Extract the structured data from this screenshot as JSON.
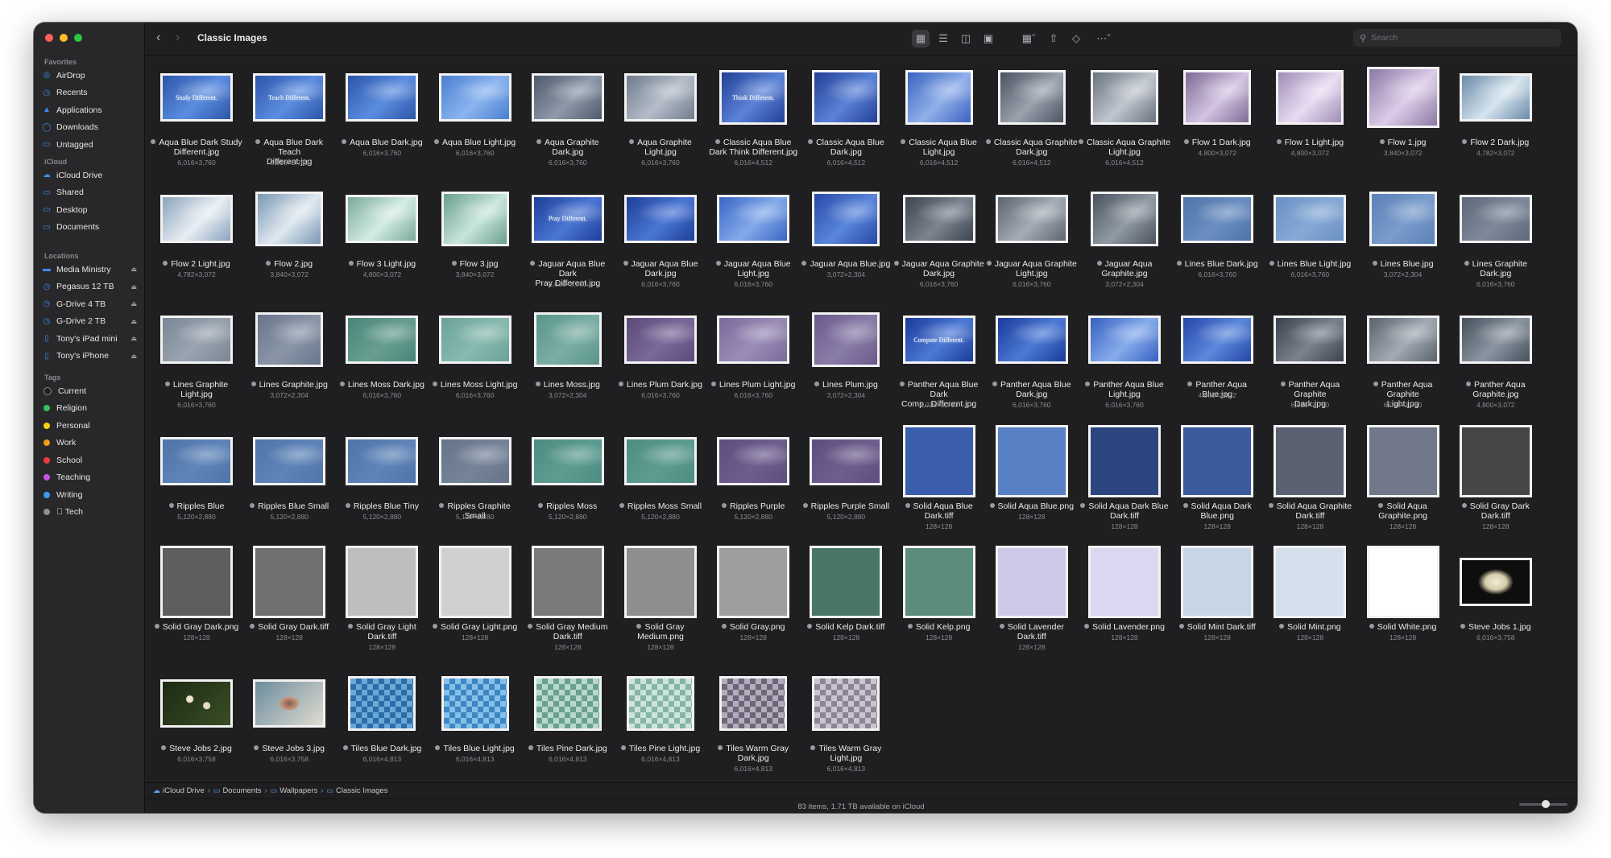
{
  "window": {
    "title": "Classic Images"
  },
  "sidebar": {
    "favorites_label": "Favorites",
    "favorites": [
      {
        "label": "AirDrop",
        "icon": "airdrop-icon"
      },
      {
        "label": "Recents",
        "icon": "clock-icon"
      },
      {
        "label": "Applications",
        "icon": "applications-icon"
      },
      {
        "label": "Downloads",
        "icon": "download-icon"
      },
      {
        "label": "Untagged",
        "icon": "folder-icon"
      }
    ],
    "icloud_label": "iCloud",
    "icloud": [
      {
        "label": "iCloud Drive",
        "icon": "cloud-icon"
      },
      {
        "label": "Shared",
        "icon": "shared-folder-icon"
      },
      {
        "label": "Desktop",
        "icon": "desktop-icon"
      },
      {
        "label": "Documents",
        "icon": "document-icon"
      }
    ],
    "locations_label": "Locations",
    "locations": [
      {
        "label": "Media Ministry",
        "icon": "drive-icon"
      },
      {
        "label": "Pegasus 12 TB",
        "icon": "clock-drive-icon"
      },
      {
        "label": "G-Drive 4 TB",
        "icon": "clock-drive-icon"
      },
      {
        "label": "G-Drive 2 TB",
        "icon": "clock-drive-icon"
      },
      {
        "label": "Tony's iPad mini",
        "icon": "ipad-icon"
      },
      {
        "label": "Tony's iPhone",
        "icon": "iphone-icon"
      }
    ],
    "tags_label": "Tags",
    "tags": [
      {
        "label": "Current",
        "color": "#1f1f21"
      },
      {
        "label": "Religion",
        "color": "#32c15a"
      },
      {
        "label": "Personal",
        "color": "#f5d10d"
      },
      {
        "label": "Work",
        "color": "#f09b12"
      },
      {
        "label": "School",
        "color": "#ee3b3b"
      },
      {
        "label": "Teaching",
        "color": "#c555e0"
      },
      {
        "label": "Writing",
        "color": "#3b9af5"
      },
      {
        "label": "Tech",
        "color": "#8e8e93",
        "prefix": " "
      }
    ]
  },
  "toolbar": {
    "back_icon": "chevron-left-icon",
    "forward_icon": "chevron-right-icon",
    "search_placeholder": "Search"
  },
  "files": [
    {
      "n1": "Aqua Blue Dark Study",
      "n2": "Different.jpg",
      "d": "6,016×3,760",
      "c": [
        "#2c55a8",
        "#5b8de0"
      ],
      "t": "Study Different.",
      "s": "w"
    },
    {
      "n1": "Aqua Blue Dark Teach",
      "n2": "Different.jpg",
      "d": "6,016×3,760",
      "c": [
        "#2c55a8",
        "#5b8de0"
      ],
      "t": "Teach Different.",
      "s": "w"
    },
    {
      "n1": "Aqua Blue Dark.jpg",
      "n2": "",
      "d": "6,016×3,760",
      "c": [
        "#2c55a8",
        "#5b8de0"
      ],
      "s": "w"
    },
    {
      "n1": "Aqua Blue Light.jpg",
      "n2": "",
      "d": "6,016×3,760",
      "c": [
        "#4a7fd0",
        "#8ab4f0"
      ],
      "s": "w"
    },
    {
      "n1": "Aqua Graphite",
      "n2": "Dark.jpg",
      "d": "6,016×3,760",
      "c": [
        "#4e5a6a",
        "#8e9aaa"
      ],
      "s": "w"
    },
    {
      "n1": "Aqua Graphite",
      "n2": "Light.jpg",
      "d": "6,016×3,760",
      "c": [
        "#707c8c",
        "#b4bcc8"
      ],
      "s": "w"
    },
    {
      "n1": "Classic Aqua Blue",
      "n2": "Dark Think Different.jpg",
      "d": "6,016×4,512",
      "c": [
        "#223f94",
        "#5a82d8"
      ],
      "t": "Think Different.",
      "s": "t"
    },
    {
      "n1": "Classic Aqua Blue",
      "n2": "Dark.jpg",
      "d": "6,016×4,512",
      "c": [
        "#223f94",
        "#5a82d8"
      ],
      "s": "t"
    },
    {
      "n1": "Classic Aqua Blue",
      "n2": "Light.jpg",
      "d": "6,016×4,512",
      "c": [
        "#3a62c0",
        "#90b0ea"
      ],
      "s": "t"
    },
    {
      "n1": "Classic Aqua Graphite",
      "n2": "Dark.jpg",
      "d": "6,016×4,512",
      "c": [
        "#4a5260",
        "#9aa2ae"
      ],
      "s": "t"
    },
    {
      "n1": "Classic Aqua Graphite",
      "n2": "Light.jpg",
      "d": "6,016×4,512",
      "c": [
        "#6a7280",
        "#c0c6ce"
      ],
      "s": "t"
    },
    {
      "n1": "Flow 1 Dark.jpg",
      "n2": "",
      "d": "4,800×3,072",
      "c": [
        "#7e6a94",
        "#d4c4e2"
      ],
      "s": "t"
    },
    {
      "n1": "Flow 1 Light.jpg",
      "n2": "",
      "d": "4,800×3,072",
      "c": [
        "#a08cb6",
        "#e8dcf2"
      ],
      "s": "t"
    },
    {
      "n1": "Flow 1.jpg",
      "n2": "",
      "d": "3,840×3,072",
      "c": [
        "#8c78a4",
        "#dccce8"
      ],
      "s": "tl"
    },
    {
      "n1": "Flow 2 Dark.jpg",
      "n2": "",
      "d": "4,782×3,072",
      "c": [
        "#6a8aa8",
        "#d6e4ee"
      ],
      "s": "w"
    },
    {
      "n1": "Flow 2 Light.jpg",
      "n2": "",
      "d": "4,782×3,072",
      "c": [
        "#8aa4bc",
        "#e8eef4"
      ],
      "s": "w"
    },
    {
      "n1": "Flow 2.jpg",
      "n2": "",
      "d": "3,840×3,072",
      "c": [
        "#7a98b4",
        "#dfe8f0"
      ],
      "s": "t"
    },
    {
      "n1": "Flow 3 Light.jpg",
      "n2": "",
      "d": "4,800×3,072",
      "c": [
        "#7aaa9a",
        "#d4ece2"
      ],
      "s": "w"
    },
    {
      "n1": "Flow 3.jpg",
      "n2": "",
      "d": "3,840×3,072",
      "c": [
        "#6a9e8e",
        "#c8e6da"
      ],
      "s": "t"
    },
    {
      "n1": "Jaguar Aqua Blue Dark",
      "n2": "Pray Different.jpg",
      "d": "6,016×3,760",
      "c": [
        "#1e3e98",
        "#4a76d4"
      ],
      "t": "Pray Different.",
      "s": "w"
    },
    {
      "n1": "Jaguar Aqua Blue",
      "n2": "Dark.jpg",
      "d": "6,016×3,760",
      "c": [
        "#1e3e98",
        "#4a76d4"
      ],
      "s": "w"
    },
    {
      "n1": "Jaguar Aqua Blue",
      "n2": "Light.jpg",
      "d": "6,016×3,760",
      "c": [
        "#3a66c4",
        "#84aaea"
      ],
      "s": "w"
    },
    {
      "n1": "Jaguar Aqua Blue.jpg",
      "n2": "",
      "d": "3,072×2,304",
      "c": [
        "#2648a8",
        "#5a86dc"
      ],
      "s": "t"
    },
    {
      "n1": "Jaguar Aqua Graphite",
      "n2": "Dark.jpg",
      "d": "6,016×3,760",
      "c": [
        "#3c4450",
        "#7c8490"
      ],
      "s": "w"
    },
    {
      "n1": "Jaguar Aqua Graphite",
      "n2": "Light.jpg",
      "d": "6,016×3,760",
      "c": [
        "#5c646e",
        "#a4acb6"
      ],
      "s": "w"
    },
    {
      "n1": "Jaguar Aqua",
      "n2": "Graphite.jpg",
      "d": "3,072×2,304",
      "c": [
        "#4a525e",
        "#909aa4"
      ],
      "s": "t"
    },
    {
      "n1": "Lines Blue Dark.jpg",
      "n2": "",
      "d": "6,016×3,760",
      "c": [
        "#4e74a8",
        "#6a8ec0"
      ],
      "s": "w"
    },
    {
      "n1": "Lines Blue Light.jpg",
      "n2": "",
      "d": "6,016×3,760",
      "c": [
        "#6a90c4",
        "#86aad6"
      ],
      "s": "w"
    },
    {
      "n1": "Lines Blue.jpg",
      "n2": "",
      "d": "3,072×2,304",
      "c": [
        "#5a80b6",
        "#7a9ccc"
      ],
      "s": "t"
    },
    {
      "n1": "Lines Graphite",
      "n2": "Dark.jpg",
      "d": "6,016×3,760",
      "c": [
        "#5c6878",
        "#7e8a9a"
      ],
      "s": "w"
    },
    {
      "n1": "Lines Graphite",
      "n2": "Light.jpg",
      "d": "6,016×3,760",
      "c": [
        "#7a8694",
        "#9aa4b0"
      ],
      "s": "w"
    },
    {
      "n1": "Lines Graphite.jpg",
      "n2": "",
      "d": "3,072×2,304",
      "c": [
        "#68748a",
        "#8a96a8"
      ],
      "s": "t"
    },
    {
      "n1": "Lines Moss Dark.jpg",
      "n2": "",
      "d": "6,016×3,760",
      "c": [
        "#4a8478",
        "#689e92"
      ],
      "s": "w"
    },
    {
      "n1": "Lines Moss Light.jpg",
      "n2": "",
      "d": "6,016×3,760",
      "c": [
        "#6aa298",
        "#88bab0"
      ],
      "s": "w"
    },
    {
      "n1": "Lines Moss.jpg",
      "n2": "",
      "d": "3,072×2,304",
      "c": [
        "#5a958a",
        "#7aaea4"
      ],
      "s": "t"
    },
    {
      "n1": "Lines Plum Dark.jpg",
      "n2": "",
      "d": "6,016×3,760",
      "c": [
        "#5c4a7c",
        "#7a6898"
      ],
      "s": "w"
    },
    {
      "n1": "Lines Plum Light.jpg",
      "n2": "",
      "d": "6,016×3,760",
      "c": [
        "#7a6a9c",
        "#9a8cb6"
      ],
      "s": "w"
    },
    {
      "n1": "Lines Plum.jpg",
      "n2": "",
      "d": "3,072×2,304",
      "c": [
        "#6a5a8c",
        "#8a7ca8"
      ],
      "s": "t"
    },
    {
      "n1": "Panther Aqua Blue",
      "n2": "Dark Comp...Different.jpg",
      "d": "6,016×3,760",
      "c": [
        "#1a3a98",
        "#4c7ad6"
      ],
      "t": "Compute Different.",
      "s": "w"
    },
    {
      "n1": "Panther Aqua Blue",
      "n2": "Dark.jpg",
      "d": "6,016×3,760",
      "c": [
        "#1a3a98",
        "#4c7ad6"
      ],
      "s": "w"
    },
    {
      "n1": "Panther Aqua Blue",
      "n2": "Light.jpg",
      "d": "6,016×3,760",
      "c": [
        "#3660c0",
        "#86acec"
      ],
      "s": "w"
    },
    {
      "n1": "Panther Aqua Blue.jpg",
      "n2": "",
      "d": "4,800×3,072",
      "c": [
        "#2446a8",
        "#5c88dc"
      ],
      "s": "w"
    },
    {
      "n1": "Panther Aqua Graphite",
      "n2": "Dark.jpg",
      "d": "6,016×3,760",
      "c": [
        "#3a424e",
        "#7a828e"
      ],
      "s": "w"
    },
    {
      "n1": "Panther Aqua Graphite",
      "n2": "Light.jpg",
      "d": "6,016×3,760",
      "c": [
        "#5a626c",
        "#a2aab4"
      ],
      "s": "w"
    },
    {
      "n1": "Panther Aqua",
      "n2": "Graphite.jpg",
      "d": "4,800×3,072",
      "c": [
        "#46505c",
        "#8c96a2"
      ],
      "s": "w"
    },
    {
      "n1": "Ripples Blue",
      "n2": "",
      "d": "5,120×2,880",
      "c": [
        "#4e74a8",
        "#5e84b8"
      ],
      "s": "w"
    },
    {
      "n1": "Ripples Blue Small",
      "n2": "",
      "d": "5,120×2,880",
      "c": [
        "#4e74a8",
        "#5e84b8"
      ],
      "s": "w"
    },
    {
      "n1": "Ripples Blue Tiny",
      "n2": "",
      "d": "5,120×2,880",
      "c": [
        "#4e74a8",
        "#5e84b8"
      ],
      "s": "w"
    },
    {
      "n1": "Ripples Graphite Small",
      "n2": "",
      "d": "5,120×2,880",
      "c": [
        "#66748a",
        "#76849a"
      ],
      "s": "w"
    },
    {
      "n1": "Ripples Moss",
      "n2": "",
      "d": "5,120×2,880",
      "c": [
        "#4e8c82",
        "#5e9c92"
      ],
      "s": "w"
    },
    {
      "n1": "Ripples Moss Small",
      "n2": "",
      "d": "5,120×2,880",
      "c": [
        "#4e8c82",
        "#5e9c92"
      ],
      "s": "w"
    },
    {
      "n1": "Ripples Purple",
      "n2": "",
      "d": "5,120×2,880",
      "c": [
        "#5e4e7e",
        "#6e5e8e"
      ],
      "s": "w"
    },
    {
      "n1": "Ripples Purple Small",
      "n2": "",
      "d": "5,120×2,880",
      "c": [
        "#5e4e7e",
        "#6e5e8e"
      ],
      "s": "w"
    },
    {
      "n1": "Solid Aqua Blue",
      "n2": "Dark.tiff",
      "d": "128×128",
      "c": [
        "#3a5eac",
        "#3a5eac"
      ],
      "s": "sq"
    },
    {
      "n1": "Solid Aqua Blue.png",
      "n2": "",
      "d": "128×128",
      "c": [
        "#5880c4",
        "#5880c4"
      ],
      "s": "sq"
    },
    {
      "n1": "Solid Aqua Dark Blue",
      "n2": "Dark.tiff",
      "d": "128×128",
      "c": [
        "#2c4680",
        "#2c4680"
      ],
      "s": "sq"
    },
    {
      "n1": "Solid Aqua Dark",
      "n2": "Blue.png",
      "d": "128×128",
      "c": [
        "#3c5a9e",
        "#3c5a9e"
      ],
      "s": "sq"
    },
    {
      "n1": "Solid Aqua Graphite",
      "n2": "Dark.tiff",
      "d": "128×128",
      "c": [
        "#5a6272",
        "#5a6272"
      ],
      "s": "sq"
    },
    {
      "n1": "Solid Aqua",
      "n2": "Graphite.png",
      "d": "128×128",
      "c": [
        "#70788a",
        "#70788a"
      ],
      "s": "sq"
    },
    {
      "n1": "Solid Gray Dark",
      "n2": "Dark.tiff",
      "d": "128×128",
      "c": [
        "#464646",
        "#464646"
      ],
      "s": "sq"
    },
    {
      "n1": "Solid Gray Dark.png",
      "n2": "",
      "d": "128×128",
      "c": [
        "#5e5e5e",
        "#5e5e5e"
      ],
      "s": "sq"
    },
    {
      "n1": "Solid Gray Dark.tiff",
      "n2": "",
      "d": "128×128",
      "c": [
        "#707070",
        "#707070"
      ],
      "s": "sq"
    },
    {
      "n1": "Solid Gray Light",
      "n2": "Dark.tiff",
      "d": "128×128",
      "c": [
        "#bebebe",
        "#bebebe"
      ],
      "s": "sq"
    },
    {
      "n1": "Solid Gray Light.png",
      "n2": "",
      "d": "128×128",
      "c": [
        "#cfcfcf",
        "#cfcfcf"
      ],
      "s": "sq"
    },
    {
      "n1": "Solid Gray Medium",
      "n2": "Dark.tiff",
      "d": "128×128",
      "c": [
        "#7a7a7a",
        "#7a7a7a"
      ],
      "s": "sq"
    },
    {
      "n1": "Solid Gray",
      "n2": "Medium.png",
      "d": "128×128",
      "c": [
        "#8e8e8e",
        "#8e8e8e"
      ],
      "s": "sq"
    },
    {
      "n1": "Solid Gray.png",
      "n2": "",
      "d": "128×128",
      "c": [
        "#9e9e9e",
        "#9e9e9e"
      ],
      "s": "sq"
    },
    {
      "n1": "Solid Kelp Dark.tiff",
      "n2": "",
      "d": "128×128",
      "c": [
        "#4a7666",
        "#4a7666"
      ],
      "s": "sq"
    },
    {
      "n1": "Solid Kelp.png",
      "n2": "",
      "d": "128×128",
      "c": [
        "#5c8c7c",
        "#5c8c7c"
      ],
      "s": "sq"
    },
    {
      "n1": "Solid Lavender",
      "n2": "Dark.tiff",
      "d": "128×128",
      "c": [
        "#d0c8e8",
        "#d0c8e8"
      ],
      "s": "sq"
    },
    {
      "n1": "Solid Lavender.png",
      "n2": "",
      "d": "128×128",
      "c": [
        "#ddd6f0",
        "#ddd6f0"
      ],
      "s": "sq"
    },
    {
      "n1": "Solid Mint Dark.tiff",
      "n2": "",
      "d": "128×128",
      "c": [
        "#c6d6e6",
        "#c6d6e6"
      ],
      "s": "sq"
    },
    {
      "n1": "Solid Mint.png",
      "n2": "",
      "d": "128×128",
      "c": [
        "#d4e0ec",
        "#d4e0ec"
      ],
      "s": "sq"
    },
    {
      "n1": "Solid White.png",
      "n2": "",
      "d": "128×128",
      "c": [
        "#ffffff",
        "#ffffff"
      ],
      "s": "sq"
    },
    {
      "n1": "Steve Jobs 1.jpg",
      "n2": "",
      "d": "6,016×3,758",
      "c": [
        "#0e0e0c",
        "#1c1c18"
      ],
      "s": "w",
      "img": "flower"
    },
    {
      "n1": "Steve Jobs 2.jpg",
      "n2": "",
      "d": "6,016×3,758",
      "c": [
        "#1c2a14",
        "#3a4e26"
      ],
      "s": "w",
      "img": "leaves"
    },
    {
      "n1": "Steve Jobs 3.jpg",
      "n2": "",
      "d": "6,016×3,758",
      "c": [
        "#6c8c9e",
        "#e0dcd0"
      ],
      "s": "w",
      "img": "blossom"
    },
    {
      "n1": "Tiles Blue Dark.jpg",
      "n2": "",
      "d": "6,016×4,813",
      "c": [
        "#2a6ea8",
        "#6aa8d8"
      ],
      "s": "t",
      "img": "tiles"
    },
    {
      "n1": "Tiles Blue Light.jpg",
      "n2": "",
      "d": "6,016×4,813",
      "c": [
        "#3c86c4",
        "#86c0e8"
      ],
      "s": "t",
      "img": "tiles"
    },
    {
      "n1": "Tiles Pine Dark.jpg",
      "n2": "",
      "d": "6,016×4,813",
      "c": [
        "#6aa090",
        "#b8d8cc"
      ],
      "s": "t",
      "img": "tiles"
    },
    {
      "n1": "Tiles Pine Light.jpg",
      "n2": "",
      "d": "6,016×4,813",
      "c": [
        "#86b4a6",
        "#cce4da"
      ],
      "s": "t",
      "img": "tiles"
    },
    {
      "n1": "Tiles Warm Gray",
      "n2": "Dark.jpg",
      "d": "6,016×4,813",
      "c": [
        "#6e6678",
        "#b4acbc"
      ],
      "s": "t",
      "img": "tiles"
    },
    {
      "n1": "Tiles Warm Gray",
      "n2": "Light.jpg",
      "d": "6,016×4,813",
      "c": [
        "#8a8494",
        "#cac4d0"
      ],
      "s": "t",
      "img": "tiles"
    }
  ],
  "pathbar": [
    {
      "label": "iCloud Drive",
      "icon": "cloud-icon"
    },
    {
      "label": "Documents",
      "icon": "folder-icon"
    },
    {
      "label": "Wallpapers",
      "icon": "folder-icon"
    },
    {
      "label": "Classic Images",
      "icon": "folder-icon"
    }
  ],
  "status": {
    "text": "83 items, 1.71 TB available on iCloud",
    "zoom_level": 0.55
  }
}
